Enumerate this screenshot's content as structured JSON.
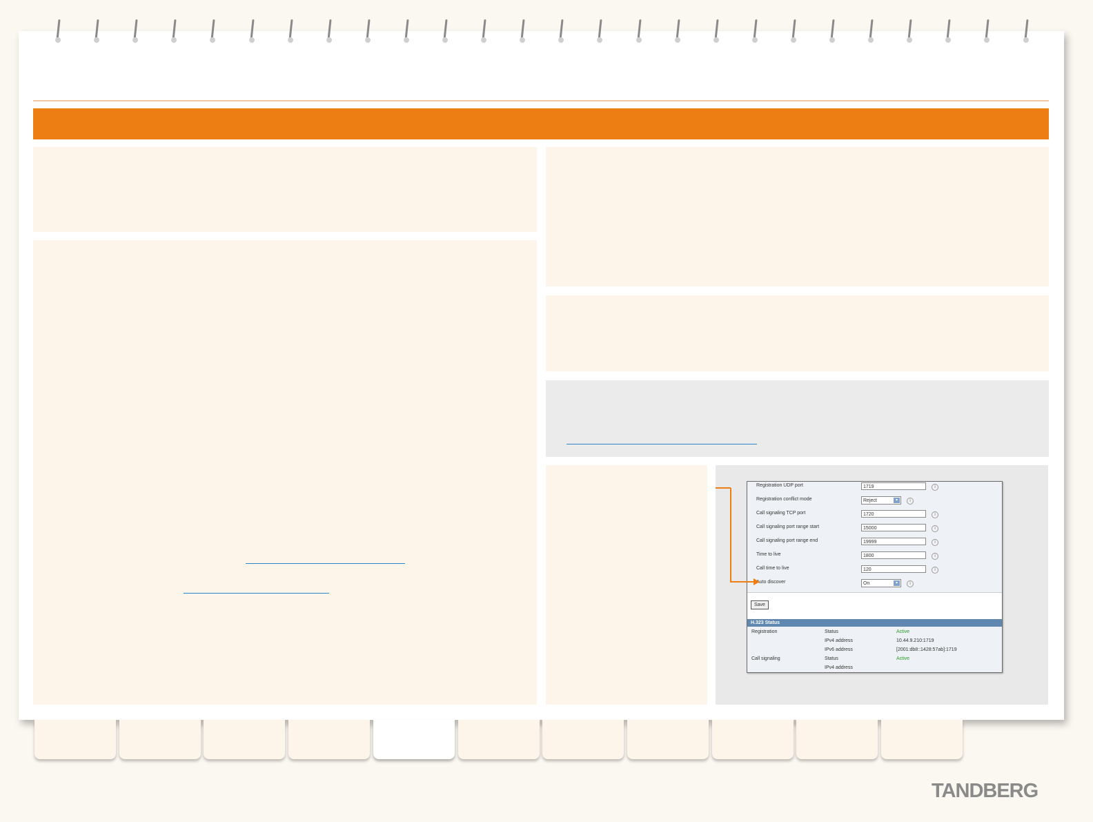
{
  "brand": {
    "logo_text": "TANDBERG",
    "accent": "#ec7e14"
  },
  "screenshot": {
    "fields": [
      {
        "label": "Registration UDP port",
        "value": "1719",
        "type": "text"
      },
      {
        "label": "Registration conflict mode",
        "value": "Reject",
        "type": "select"
      },
      {
        "label": "Call signaling TCP port",
        "value": "1720",
        "type": "text"
      },
      {
        "label": "Call signaling port range start",
        "value": "15000",
        "type": "text"
      },
      {
        "label": "Call signaling port range end",
        "value": "19999",
        "type": "text"
      },
      {
        "label": "Time to live",
        "value": "1800",
        "type": "text"
      },
      {
        "label": "Call time to live",
        "value": "120",
        "type": "text"
      },
      {
        "label": "Auto discover",
        "value": "On",
        "type": "select"
      }
    ],
    "save_label": "Save",
    "status_heading": "H.323 Status",
    "status_rows": [
      {
        "section": "Registration",
        "key": "Status",
        "value": "Active",
        "state": "active"
      },
      {
        "section": "",
        "key": "IPv4 address",
        "value": "10.44.9.210:1719",
        "state": ""
      },
      {
        "section": "",
        "key": "IPv6 address",
        "value": "[2001:db8::1428:57ab]:1719",
        "state": ""
      },
      {
        "section": "Call signaling",
        "key": "Status",
        "value": "Active",
        "state": "active"
      },
      {
        "section": "",
        "key": "IPv4 address",
        "value": "",
        "state": ""
      }
    ]
  },
  "tabs": {
    "count": 11,
    "active_index": 4
  }
}
